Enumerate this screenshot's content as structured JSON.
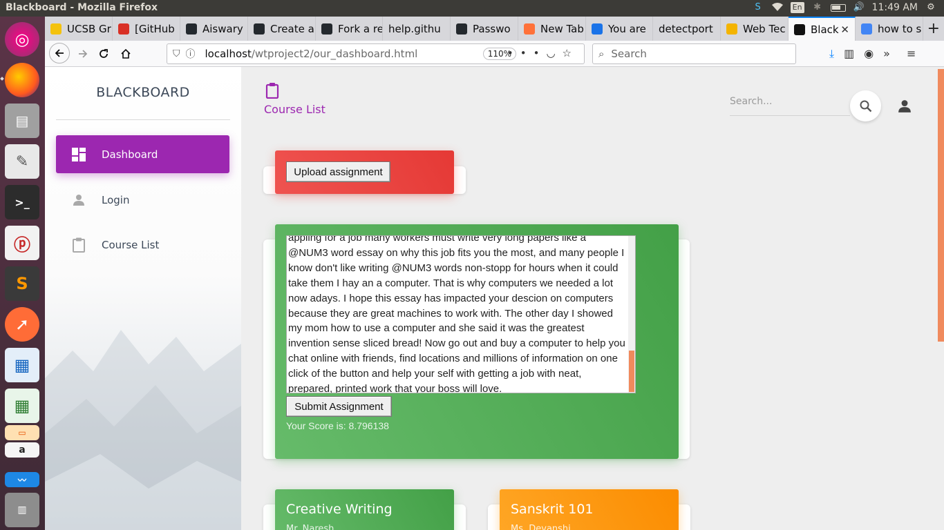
{
  "os": {
    "window_title": "Blackboard - Mozilla Firefox",
    "keyboard_lang": "En",
    "clock": "11:49 AM"
  },
  "browser": {
    "tabs": [
      {
        "label": "UCSB Gr",
        "icon": "ucsb-favicon",
        "color": "#f4c20d"
      },
      {
        "label": "[GitHub",
        "icon": "gmail-favicon",
        "color": "#d93025"
      },
      {
        "label": "Aiswary",
        "icon": "github-favicon",
        "color": "#24292e"
      },
      {
        "label": "Create a",
        "icon": "github-favicon",
        "color": "#24292e"
      },
      {
        "label": "Fork a re",
        "icon": "github-favicon",
        "color": "#24292e"
      },
      {
        "label": "help.githu",
        "icon": "none",
        "color": ""
      },
      {
        "label": "Passwo",
        "icon": "github-favicon",
        "color": "#24292e"
      },
      {
        "label": "New Tab",
        "icon": "firefox-favicon",
        "color": "#ff7139"
      },
      {
        "label": "You are",
        "icon": "s-favicon",
        "color": "#1a73e8"
      },
      {
        "label": "detectport",
        "icon": "none",
        "color": ""
      },
      {
        "label": "Web Tec",
        "icon": "slides-favicon",
        "color": "#f4b400"
      },
      {
        "label": "Black",
        "icon": "bowtie-favicon",
        "color": "#111111"
      },
      {
        "label": "how to s",
        "icon": "google-favicon",
        "color": "#4285f4"
      }
    ],
    "url_host": "localhost",
    "url_path": "/wtproject2/our_dashboard.html",
    "zoom": "110%",
    "search_placeholder": "Search"
  },
  "sidebar": {
    "brand": "BLACKBOARD",
    "items": [
      {
        "label": "Dashboard",
        "icon": "dashboard-icon",
        "active": true
      },
      {
        "label": "Login",
        "icon": "person-icon",
        "active": false
      },
      {
        "label": "Course List",
        "icon": "clipboard-icon",
        "active": false
      }
    ]
  },
  "header": {
    "title": "Course List",
    "search_placeholder": "Search..."
  },
  "upload_card": {
    "button_label": "Upload assignment"
  },
  "submission_card": {
    "essay_text": "appling for a job many workers must write very long papers like a @NUM3 word essay on why this job fits you the most, and many people I know don't like writing @NUM3 words non-stopp for hours when it could take them I hay an a computer. That is why computers we needed a lot now adays. I hope this essay has impacted your descion on computers because they are great machines to work with. The other day I showed my mom how to use a computer and she said it was the greatest invention sense sliced bread! Now go out and buy a computer to help you chat online with friends, find locations and millions of information on one click of the button and help your self with getting a job with neat, prepared, printed work that your boss will love.",
    "submit_label": "Submit Assignment",
    "score_text": "Your Score is: 8.796138"
  },
  "courses": [
    {
      "title": "Creative Writing",
      "teacher": "Mr. Naresh",
      "color": "#4caf50"
    },
    {
      "title": "Sanskrit 101",
      "teacher": "Ms. Devanshi",
      "color": "#ff9800"
    }
  ],
  "colors": {
    "accent": "#9c27b0",
    "red": "#e53935",
    "green": "#43a047",
    "orange": "#fb8c00"
  }
}
